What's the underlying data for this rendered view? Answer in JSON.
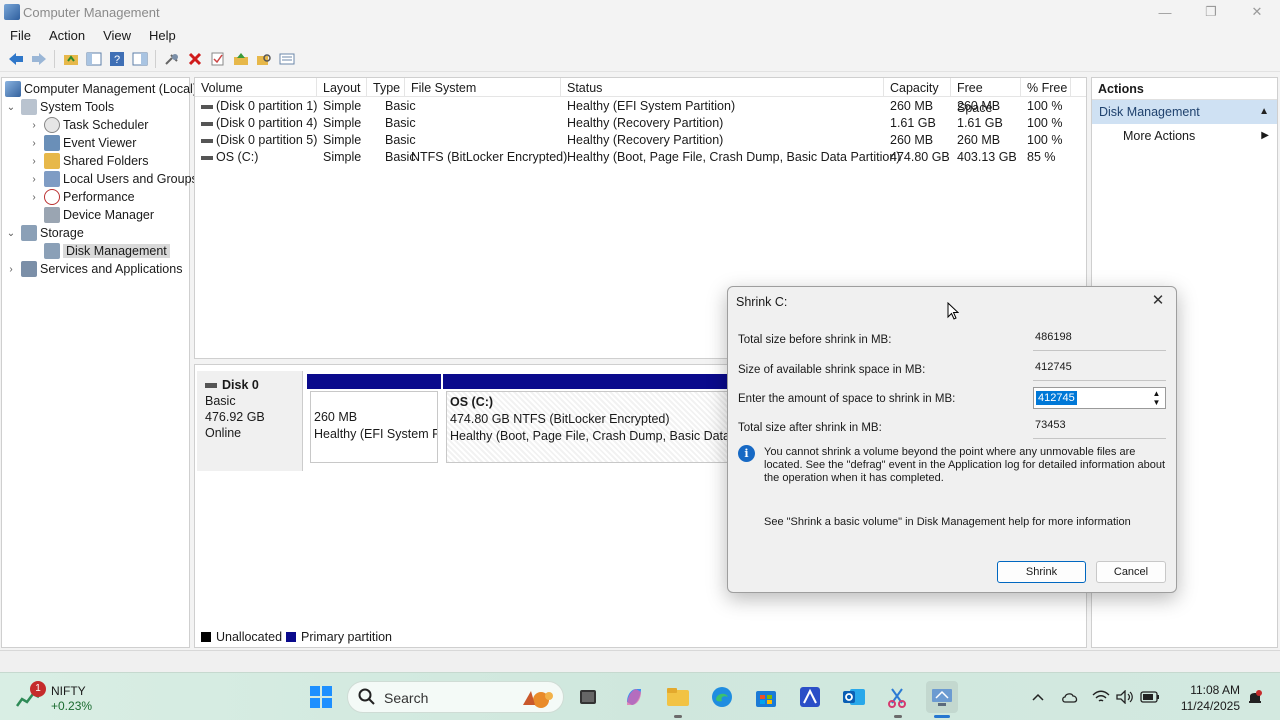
{
  "window": {
    "title": "Computer Management",
    "minimize_label": "—",
    "restore_label": "❐",
    "close_label": "✕"
  },
  "menu": [
    "File",
    "Action",
    "View",
    "Help"
  ],
  "tree": {
    "root": "Computer Management (Local)",
    "system_tools": "System Tools",
    "items": [
      "Task Scheduler",
      "Event Viewer",
      "Shared Folders",
      "Local Users and Groups",
      "Performance",
      "Device Manager"
    ],
    "storage": "Storage",
    "disk_management": "Disk Management",
    "services": "Services and Applications"
  },
  "volumes": {
    "headers": [
      "Volume",
      "Layout",
      "Type",
      "File System",
      "Status",
      "Capacity",
      "Free Space",
      "% Free"
    ],
    "rows": [
      [
        "(Disk 0 partition 1)",
        "Simple",
        "Basic",
        "",
        "Healthy (EFI System Partition)",
        "260 MB",
        "260 MB",
        "100 %"
      ],
      [
        "(Disk 0 partition 4)",
        "Simple",
        "Basic",
        "",
        "Healthy (Recovery Partition)",
        "1.61 GB",
        "1.61 GB",
        "100 %"
      ],
      [
        "(Disk 0 partition 5)",
        "Simple",
        "Basic",
        "",
        "Healthy (Recovery Partition)",
        "260 MB",
        "260 MB",
        "100 %"
      ],
      [
        "OS (C:)",
        "Simple",
        "Basic",
        "NTFS (BitLocker Encrypted)",
        "Healthy (Boot, Page File, Crash Dump, Basic Data Partition)",
        "474.80 GB",
        "403.13 GB",
        "85 %"
      ]
    ]
  },
  "disk": {
    "name": "Disk 0",
    "type": "Basic",
    "size": "476.92 GB",
    "state": "Online",
    "efi": {
      "size": "260 MB",
      "status": "Healthy (EFI System Pa"
    },
    "os": {
      "name": "OS  (C:)",
      "size": "474.80 GB NTFS (BitLocker Encrypted)",
      "status": "Healthy (Boot, Page File, Crash Dump, Basic Data Partition)"
    }
  },
  "legend": {
    "unallocated": "Unallocated",
    "primary": "Primary partition"
  },
  "actions": {
    "title": "Actions",
    "section": "Disk Management",
    "more": "More Actions"
  },
  "dialog": {
    "title": "Shrink C:",
    "total_before_label": "Total size before shrink in MB:",
    "total_before_value": "486198",
    "available_label": "Size of available shrink space in MB:",
    "available_value": "412745",
    "amount_label": "Enter the amount of space to shrink in MB:",
    "amount_value": "412745",
    "total_after_label": "Total size after shrink in MB:",
    "total_after_value": "73453",
    "info": "You cannot shrink a volume beyond the point where any unmovable files are located. See the \"defrag\" event in the Application log for detailed information about the operation when it has completed.",
    "help": "See \"Shrink a basic volume\" in Disk Management help for more information",
    "shrink_button": "Shrink",
    "cancel_button": "Cancel"
  },
  "taskbar": {
    "widget_name": "NIFTY",
    "widget_change": "+0.23%",
    "widget_badge": "1",
    "search_placeholder": "Search",
    "time": "11:08 AM",
    "date": "11/24/2025"
  },
  "colors": {
    "primary_partition": "#0a0a8c",
    "selection": "#0078d7",
    "actions_highlight": "#cfe1f3"
  }
}
